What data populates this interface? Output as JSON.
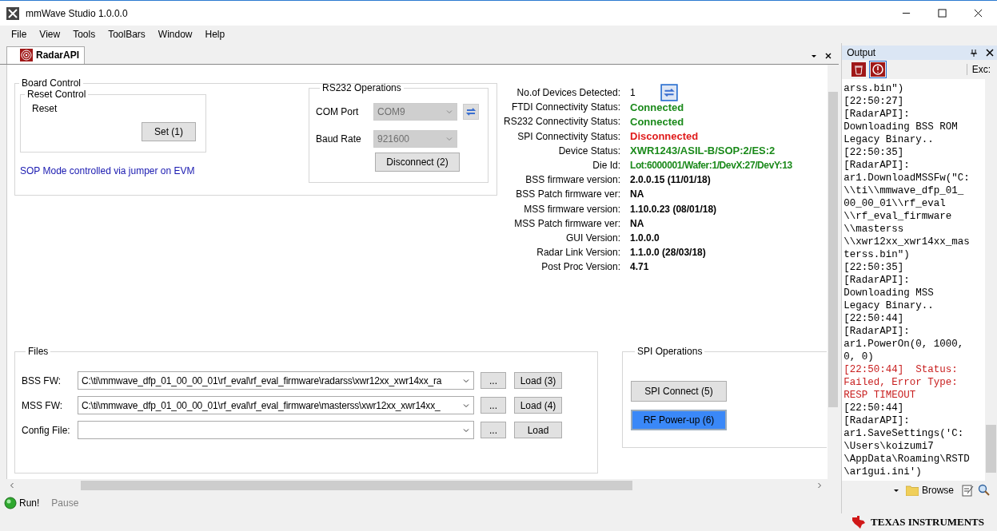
{
  "window": {
    "title": "mmWave Studio 1.0.0.0"
  },
  "menu": [
    "File",
    "View",
    "Tools",
    "ToolBars",
    "Window",
    "Help"
  ],
  "tabs": [
    {
      "label": "RadarAPI",
      "selected": true
    }
  ],
  "board_control": {
    "title": "Board Control",
    "reset_control": {
      "title": "Reset Control",
      "label": "Reset",
      "button": "Set (1)"
    },
    "sop_note": "SOP Mode controlled via jumper on EVM"
  },
  "rs232": {
    "title": "RS232 Operations",
    "com_port": {
      "label": "COM Port",
      "value": "COM9",
      "disabled": true
    },
    "baud_rate": {
      "label": "Baud Rate",
      "value": "921600",
      "disabled": true
    },
    "button": "Disconnect (2)"
  },
  "info": [
    {
      "label": "No.of Devices Detected:",
      "value": "1",
      "kind": "plain"
    },
    {
      "label": "FTDI Connectivity Status:",
      "value": "Connected",
      "kind": "good"
    },
    {
      "label": "RS232 Connectivity Status:",
      "value": "Connected",
      "kind": "good"
    },
    {
      "label": "SPI Connectivity Status:",
      "value": "Disconnected",
      "kind": "bad"
    },
    {
      "label": "Device Status:",
      "value": "XWR1243/ASIL-B/SOP:2/ES:2",
      "kind": "good"
    },
    {
      "label": "Die Id:",
      "value": "Lot:6000001/Wafer:1/DevX:27/DevY:13",
      "kind": "good-light"
    },
    {
      "label": "BSS firmware version:",
      "value": "2.0.0.15 (11/01/18)",
      "kind": "bold"
    },
    {
      "label": "BSS Patch firmware ver:",
      "value": "NA",
      "kind": "bold"
    },
    {
      "label": "MSS firmware version:",
      "value": "1.10.0.23 (08/01/18)",
      "kind": "bold"
    },
    {
      "label": "MSS Patch firmware ver:",
      "value": "NA",
      "kind": "bold"
    },
    {
      "label": "GUI Version:",
      "value": "1.0.0.0",
      "kind": "bold"
    },
    {
      "label": "Radar Link Version:",
      "value": "1.1.0.0 (28/03/18)",
      "kind": "bold"
    },
    {
      "label": "Post Proc Version:",
      "value": "4.71",
      "kind": "bold"
    }
  ],
  "files": {
    "title": "Files",
    "rows": [
      {
        "label": "BSS FW:",
        "value": "C:\\ti\\mmwave_dfp_01_00_00_01\\rf_eval\\rf_eval_firmware\\radarss\\xwr12xx_xwr14xx_ra",
        "browse": "...",
        "load": "Load (3)"
      },
      {
        "label": "MSS FW:",
        "value": "C:\\ti\\mmwave_dfp_01_00_00_01\\rf_eval\\rf_eval_firmware\\masterss\\xwr12xx_xwr14xx_",
        "browse": "...",
        "load": "Load (4)"
      },
      {
        "label": "Config File:",
        "browse": "...",
        "load": "Load"
      }
    ]
  },
  "spi": {
    "title": "SPI Operations",
    "buttons": [
      {
        "label": "SPI Connect (5)",
        "focused": false
      },
      {
        "label": "RF Power-up (6)",
        "focused": true
      }
    ]
  },
  "output": {
    "title": "Output",
    "filter": "Exc:",
    "log": [
      {
        "text": "arss.bin\")",
        "kind": "normal"
      },
      {
        "text": "[22:50:27]",
        "kind": "normal"
      },
      {
        "text": "[RadarAPI]:",
        "kind": "normal"
      },
      {
        "text": "Downloading BSS ROM",
        "kind": "normal"
      },
      {
        "text": "Legacy Binary..",
        "kind": "normal"
      },
      {
        "text": "[22:50:35]",
        "kind": "normal"
      },
      {
        "text": "[RadarAPI]:",
        "kind": "normal"
      },
      {
        "text": "ar1.DownloadMSSFw(\"C:",
        "kind": "normal"
      },
      {
        "text": "\\\\ti\\\\mmwave_dfp_01_",
        "kind": "normal"
      },
      {
        "text": "00_00_01\\\\rf_eval",
        "kind": "normal"
      },
      {
        "text": "\\\\rf_eval_firmware",
        "kind": "normal"
      },
      {
        "text": "\\\\masterss",
        "kind": "normal"
      },
      {
        "text": "\\\\xwr12xx_xwr14xx_mas",
        "kind": "normal"
      },
      {
        "text": "terss.bin\")",
        "kind": "normal"
      },
      {
        "text": "[22:50:35]",
        "kind": "normal"
      },
      {
        "text": "[RadarAPI]:",
        "kind": "normal"
      },
      {
        "text": "Downloading MSS",
        "kind": "normal"
      },
      {
        "text": "Legacy Binary..",
        "kind": "normal"
      },
      {
        "text": "[22:50:44]",
        "kind": "normal"
      },
      {
        "text": "[RadarAPI]:",
        "kind": "normal"
      },
      {
        "text": "ar1.PowerOn(0, 1000,",
        "kind": "normal"
      },
      {
        "text": "0, 0)",
        "kind": "normal"
      },
      {
        "text": "[22:50:44]  Status:",
        "kind": "error"
      },
      {
        "text": "Failed, Error Type:",
        "kind": "error"
      },
      {
        "text": "RESP TIMEOUT",
        "kind": "error"
      },
      {
        "text": "[22:50:44]",
        "kind": "normal"
      },
      {
        "text": "[RadarAPI]:",
        "kind": "normal"
      },
      {
        "text": "ar1.SaveSettings('C:",
        "kind": "normal"
      },
      {
        "text": "\\Users\\koizumi7",
        "kind": "normal"
      },
      {
        "text": "\\AppData\\Roaming\\RSTD",
        "kind": "normal"
      },
      {
        "text": "\\ar1gui.ini')",
        "kind": "normal"
      }
    ]
  },
  "status_bar": {
    "run": "Run!",
    "pause": {
      "label": "Pause",
      "disabled": true
    },
    "browse": "Browse"
  },
  "footer": {
    "brand": "TEXAS INSTRUMENTS"
  }
}
